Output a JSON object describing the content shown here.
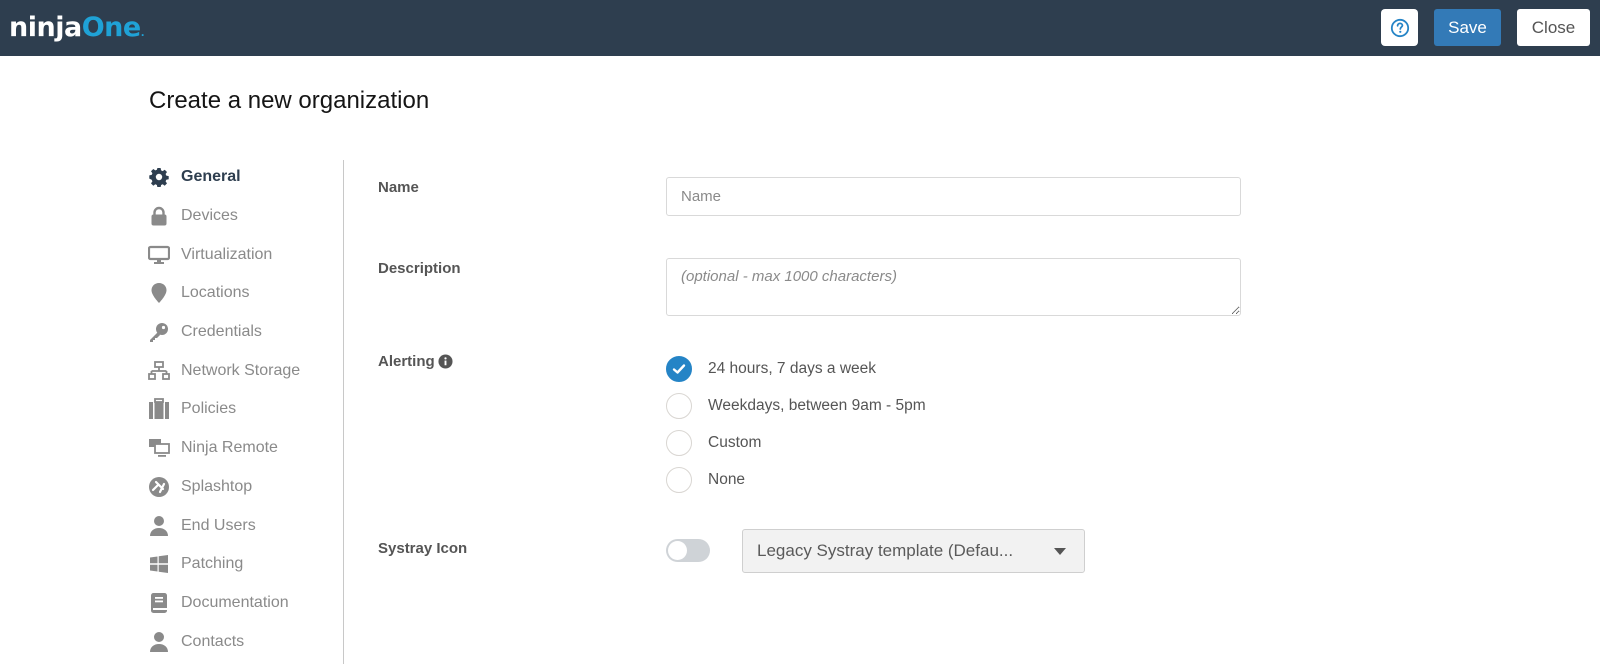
{
  "header": {
    "logo": {
      "part1": "ninja",
      "part2": "One",
      "mark": "."
    },
    "help_icon": "question-circle-icon",
    "save_label": "Save",
    "close_label": "Close"
  },
  "page": {
    "title": "Create a new organization"
  },
  "sidebar": {
    "items": [
      {
        "label": "General",
        "icon": "gear-icon",
        "active": true
      },
      {
        "label": "Devices",
        "icon": "lock-icon",
        "active": false
      },
      {
        "label": "Virtualization",
        "icon": "monitor-icon",
        "active": false
      },
      {
        "label": "Locations",
        "icon": "map-pin-icon",
        "active": false
      },
      {
        "label": "Credentials",
        "icon": "key-icon",
        "active": false
      },
      {
        "label": "Network Storage",
        "icon": "network-icon",
        "active": false
      },
      {
        "label": "Policies",
        "icon": "briefcase-icon",
        "active": false
      },
      {
        "label": "Ninja Remote",
        "icon": "remote-desktop-icon",
        "active": false
      },
      {
        "label": "Splashtop",
        "icon": "splashtop-icon",
        "active": false
      },
      {
        "label": "End Users",
        "icon": "user-icon",
        "active": false
      },
      {
        "label": "Patching",
        "icon": "windows-icon",
        "active": false
      },
      {
        "label": "Documentation",
        "icon": "book-icon",
        "active": false
      },
      {
        "label": "Contacts",
        "icon": "user-icon",
        "active": false
      }
    ]
  },
  "form": {
    "name": {
      "label": "Name",
      "value": "",
      "placeholder": "Name"
    },
    "description": {
      "label": "Description",
      "value": "",
      "placeholder": "(optional - max 1000 characters)"
    },
    "alerting": {
      "label": "Alerting",
      "info_icon": "info-circle-icon",
      "options": [
        {
          "label": "24 hours, 7 days a week",
          "checked": true
        },
        {
          "label": "Weekdays, between 9am - 5pm",
          "checked": false
        },
        {
          "label": "Custom",
          "checked": false
        },
        {
          "label": "None",
          "checked": false
        }
      ]
    },
    "systray": {
      "label": "Systray Icon",
      "enabled": false,
      "selected_template": "Legacy Systray template (Defau..."
    }
  },
  "colors": {
    "header_bg": "#2e3e4f",
    "brand_accent": "#1fa2d6",
    "primary_button": "#337ab7",
    "radio_checked": "#2584c6"
  }
}
